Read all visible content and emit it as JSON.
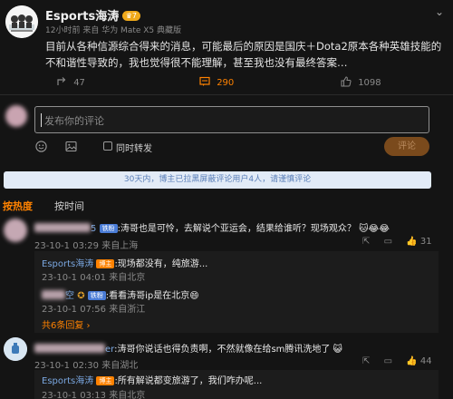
{
  "post": {
    "author": "Esports海涛",
    "level_badge": "7",
    "time": "12小时前",
    "source": "来自 华为 Mate X5 典藏版",
    "content": "目前从各种信源综合得来的消息，可能最后的原因是国庆＋Dota2原本各种英雄技能的不和谐性导致的，我也觉得很不能理解，甚至我也没有最终答案…",
    "repost_count": "47",
    "comment_count": "290",
    "like_count": "1098"
  },
  "composer": {
    "placeholder": "发布你的评论",
    "also_repost_label": "同时转发",
    "submit_label": "评论"
  },
  "notice": "30天内，博主已拉黑屏蔽评论用户4人，请谨慎评论",
  "sort": {
    "hot_label": "按热度",
    "time_label": "按时间"
  },
  "comments": [
    {
      "name_suffix": "5",
      "badge": "铁粉",
      "text": ":涛哥也是可怜，去解说个亚运会，结果给谁听？现场观众？",
      "date": "23-10-1 03:29",
      "location": "来自上海",
      "like_count": "31",
      "replies": [
        {
          "name": "Esports海涛",
          "badge": "博主",
          "text": ":现场都没有，纯旅游...",
          "date": "23-10-1 04:01",
          "location": "来自北京"
        },
        {
          "name_suffix": "空",
          "badge": "铁粉",
          "text": ":看看涛哥ip是在北京",
          "date": "23-10-1 07:56",
          "location": "来自浙江"
        }
      ],
      "more_replies": "共6条回复"
    },
    {
      "name_suffix": "er",
      "text": ":涛哥你说话也得负责啊，不然就像在给sm腾讯洗地了",
      "date": "23-10-1 02:30",
      "location": "来自湖北",
      "like_count": "44",
      "replies": [
        {
          "name": "Esports海涛",
          "badge": "博主",
          "text": ":所有解说都变旅游了，我们咋办呢...",
          "date": "23-10-1 03:13",
          "location": "来自北京"
        }
      ]
    }
  ],
  "colors": {
    "accent": "#ff8200",
    "link": "#7aa7e0",
    "background": "#141414"
  }
}
